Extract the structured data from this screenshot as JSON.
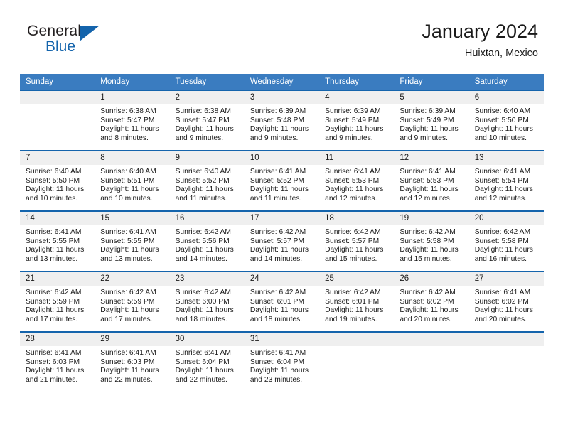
{
  "brand": {
    "name_top": "General",
    "name_bottom": "Blue"
  },
  "header": {
    "title": "January 2024",
    "subtitle": "Huixtan, Mexico"
  },
  "colors": {
    "header_blue": "#3a7cc0",
    "rule_blue": "#1464ac",
    "daynum_band": "#efefef",
    "brand_blue": "#1464ac",
    "text": "#1a1a1a"
  },
  "weekday_headers": [
    "Sunday",
    "Monday",
    "Tuesday",
    "Wednesday",
    "Thursday",
    "Friday",
    "Saturday"
  ],
  "labels": {
    "sunrise_prefix": "Sunrise:",
    "sunset_prefix": "Sunset:",
    "daylight_prefix": "Daylight:"
  },
  "weeks": [
    [
      {
        "day": "",
        "sunrise": "",
        "sunset": "",
        "daylight": "",
        "empty": true
      },
      {
        "day": "1",
        "sunrise": "Sunrise: 6:38 AM",
        "sunset": "Sunset: 5:47 PM",
        "daylight": "Daylight: 11 hours and 8 minutes."
      },
      {
        "day": "2",
        "sunrise": "Sunrise: 6:38 AM",
        "sunset": "Sunset: 5:47 PM",
        "daylight": "Daylight: 11 hours and 9 minutes."
      },
      {
        "day": "3",
        "sunrise": "Sunrise: 6:39 AM",
        "sunset": "Sunset: 5:48 PM",
        "daylight": "Daylight: 11 hours and 9 minutes."
      },
      {
        "day": "4",
        "sunrise": "Sunrise: 6:39 AM",
        "sunset": "Sunset: 5:49 PM",
        "daylight": "Daylight: 11 hours and 9 minutes."
      },
      {
        "day": "5",
        "sunrise": "Sunrise: 6:39 AM",
        "sunset": "Sunset: 5:49 PM",
        "daylight": "Daylight: 11 hours and 9 minutes."
      },
      {
        "day": "6",
        "sunrise": "Sunrise: 6:40 AM",
        "sunset": "Sunset: 5:50 PM",
        "daylight": "Daylight: 11 hours and 10 minutes."
      }
    ],
    [
      {
        "day": "7",
        "sunrise": "Sunrise: 6:40 AM",
        "sunset": "Sunset: 5:50 PM",
        "daylight": "Daylight: 11 hours and 10 minutes."
      },
      {
        "day": "8",
        "sunrise": "Sunrise: 6:40 AM",
        "sunset": "Sunset: 5:51 PM",
        "daylight": "Daylight: 11 hours and 10 minutes."
      },
      {
        "day": "9",
        "sunrise": "Sunrise: 6:40 AM",
        "sunset": "Sunset: 5:52 PM",
        "daylight": "Daylight: 11 hours and 11 minutes."
      },
      {
        "day": "10",
        "sunrise": "Sunrise: 6:41 AM",
        "sunset": "Sunset: 5:52 PM",
        "daylight": "Daylight: 11 hours and 11 minutes."
      },
      {
        "day": "11",
        "sunrise": "Sunrise: 6:41 AM",
        "sunset": "Sunset: 5:53 PM",
        "daylight": "Daylight: 11 hours and 12 minutes."
      },
      {
        "day": "12",
        "sunrise": "Sunrise: 6:41 AM",
        "sunset": "Sunset: 5:53 PM",
        "daylight": "Daylight: 11 hours and 12 minutes."
      },
      {
        "day": "13",
        "sunrise": "Sunrise: 6:41 AM",
        "sunset": "Sunset: 5:54 PM",
        "daylight": "Daylight: 11 hours and 12 minutes."
      }
    ],
    [
      {
        "day": "14",
        "sunrise": "Sunrise: 6:41 AM",
        "sunset": "Sunset: 5:55 PM",
        "daylight": "Daylight: 11 hours and 13 minutes."
      },
      {
        "day": "15",
        "sunrise": "Sunrise: 6:41 AM",
        "sunset": "Sunset: 5:55 PM",
        "daylight": "Daylight: 11 hours and 13 minutes."
      },
      {
        "day": "16",
        "sunrise": "Sunrise: 6:42 AM",
        "sunset": "Sunset: 5:56 PM",
        "daylight": "Daylight: 11 hours and 14 minutes."
      },
      {
        "day": "17",
        "sunrise": "Sunrise: 6:42 AM",
        "sunset": "Sunset: 5:57 PM",
        "daylight": "Daylight: 11 hours and 14 minutes."
      },
      {
        "day": "18",
        "sunrise": "Sunrise: 6:42 AM",
        "sunset": "Sunset: 5:57 PM",
        "daylight": "Daylight: 11 hours and 15 minutes."
      },
      {
        "day": "19",
        "sunrise": "Sunrise: 6:42 AM",
        "sunset": "Sunset: 5:58 PM",
        "daylight": "Daylight: 11 hours and 15 minutes."
      },
      {
        "day": "20",
        "sunrise": "Sunrise: 6:42 AM",
        "sunset": "Sunset: 5:58 PM",
        "daylight": "Daylight: 11 hours and 16 minutes."
      }
    ],
    [
      {
        "day": "21",
        "sunrise": "Sunrise: 6:42 AM",
        "sunset": "Sunset: 5:59 PM",
        "daylight": "Daylight: 11 hours and 17 minutes."
      },
      {
        "day": "22",
        "sunrise": "Sunrise: 6:42 AM",
        "sunset": "Sunset: 5:59 PM",
        "daylight": "Daylight: 11 hours and 17 minutes."
      },
      {
        "day": "23",
        "sunrise": "Sunrise: 6:42 AM",
        "sunset": "Sunset: 6:00 PM",
        "daylight": "Daylight: 11 hours and 18 minutes."
      },
      {
        "day": "24",
        "sunrise": "Sunrise: 6:42 AM",
        "sunset": "Sunset: 6:01 PM",
        "daylight": "Daylight: 11 hours and 18 minutes."
      },
      {
        "day": "25",
        "sunrise": "Sunrise: 6:42 AM",
        "sunset": "Sunset: 6:01 PM",
        "daylight": "Daylight: 11 hours and 19 minutes."
      },
      {
        "day": "26",
        "sunrise": "Sunrise: 6:42 AM",
        "sunset": "Sunset: 6:02 PM",
        "daylight": "Daylight: 11 hours and 20 minutes."
      },
      {
        "day": "27",
        "sunrise": "Sunrise: 6:41 AM",
        "sunset": "Sunset: 6:02 PM",
        "daylight": "Daylight: 11 hours and 20 minutes."
      }
    ],
    [
      {
        "day": "28",
        "sunrise": "Sunrise: 6:41 AM",
        "sunset": "Sunset: 6:03 PM",
        "daylight": "Daylight: 11 hours and 21 minutes."
      },
      {
        "day": "29",
        "sunrise": "Sunrise: 6:41 AM",
        "sunset": "Sunset: 6:03 PM",
        "daylight": "Daylight: 11 hours and 22 minutes."
      },
      {
        "day": "30",
        "sunrise": "Sunrise: 6:41 AM",
        "sunset": "Sunset: 6:04 PM",
        "daylight": "Daylight: 11 hours and 22 minutes."
      },
      {
        "day": "31",
        "sunrise": "Sunrise: 6:41 AM",
        "sunset": "Sunset: 6:04 PM",
        "daylight": "Daylight: 11 hours and 23 minutes."
      },
      {
        "day": "",
        "sunrise": "",
        "sunset": "",
        "daylight": "",
        "empty": true
      },
      {
        "day": "",
        "sunrise": "",
        "sunset": "",
        "daylight": "",
        "empty": true
      },
      {
        "day": "",
        "sunrise": "",
        "sunset": "",
        "daylight": "",
        "empty": true
      }
    ]
  ]
}
